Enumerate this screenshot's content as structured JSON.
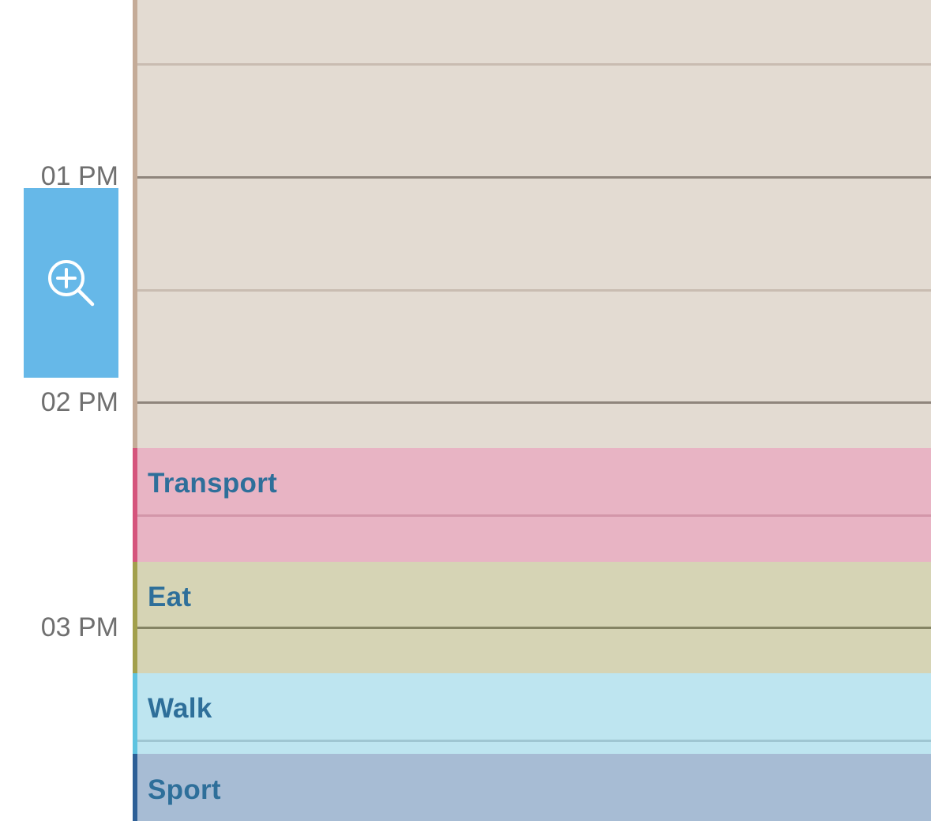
{
  "time_labels": {
    "pm01": "01 PM",
    "pm02": "02 PM",
    "pm03": "03 PM"
  },
  "zoom_button": {
    "icon": "zoom-in-icon",
    "color": "#66b8e8"
  },
  "activities": [
    {
      "label": "Transport",
      "color": "#e8b4c4",
      "stripe": "#d5547c"
    },
    {
      "label": "Eat",
      "color": "#d6d4b5",
      "stripe": "#a2a04c"
    },
    {
      "label": "Walk",
      "color": "#bee5f0",
      "stripe": "#5ec3e0"
    },
    {
      "label": "Sport",
      "color": "#a7bcd4",
      "stripe": "#2d5f96"
    }
  ],
  "idle_block": {
    "color": "#e3dbd2",
    "stripe": "#c4ab98"
  }
}
